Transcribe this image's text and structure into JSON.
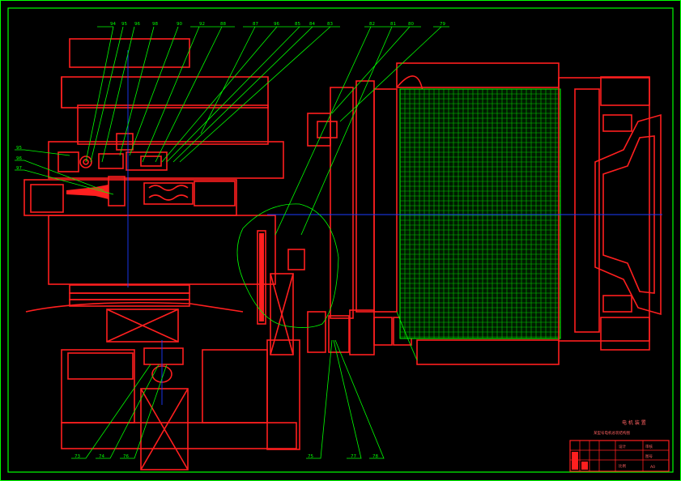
{
  "drawing": {
    "callouts_top": [
      "94",
      "95",
      "96",
      "98",
      "90",
      "92",
      "88",
      "87",
      "96",
      "85",
      "84",
      "83",
      "82",
      "81",
      "80",
      "79"
    ],
    "callouts_left": [
      "95",
      "96",
      "97"
    ],
    "callouts_bottom_left": [
      "73",
      "74",
      "76"
    ],
    "callouts_bottom_center": [
      "75",
      "77",
      "78"
    ],
    "title_block": {
      "title_line_1": "电 机 装 置",
      "title_line_2": "某型号电机总装结构图",
      "cells": [
        "设计",
        "审核",
        "比例",
        "图号"
      ],
      "sheet": "A0"
    }
  },
  "colors": {
    "background": "#000000",
    "outline": "#ff1f1f",
    "leader": "#00ff00",
    "centerline": "#1b3bff"
  }
}
